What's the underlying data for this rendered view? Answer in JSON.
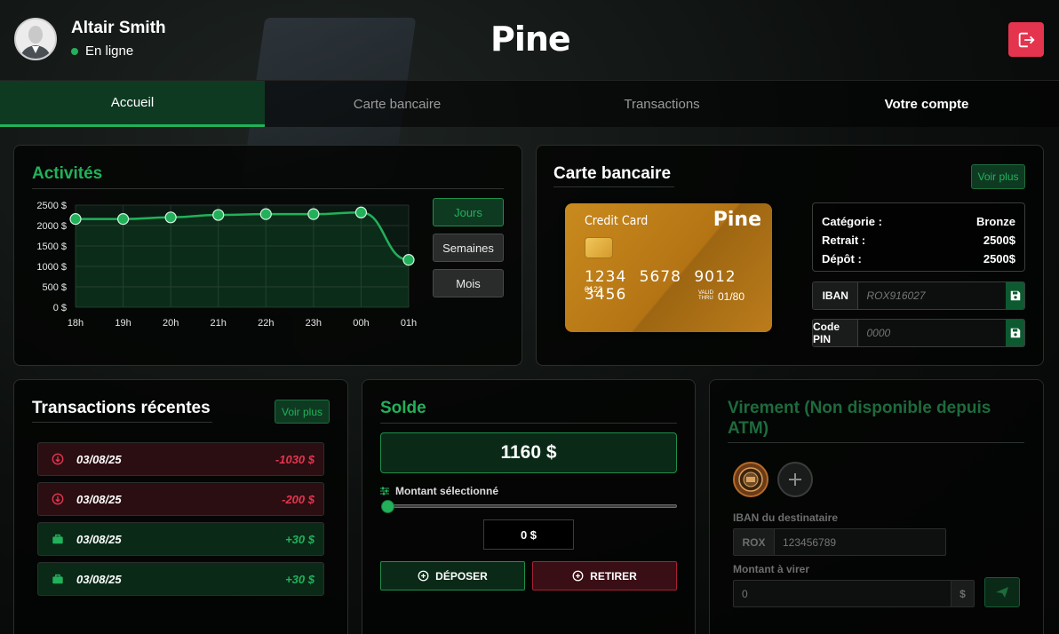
{
  "user": {
    "name": "Altair Smith",
    "status": "En ligne"
  },
  "logo": "Pine",
  "tabs": [
    {
      "label": "Accueil"
    },
    {
      "label": "Carte bancaire"
    },
    {
      "label": "Transactions"
    },
    {
      "label": "Votre compte"
    }
  ],
  "activity": {
    "title": "Activités",
    "buttons": [
      "Jours",
      "Semaines",
      "Mois"
    ]
  },
  "chart_data": {
    "type": "line",
    "title": "Activités",
    "x": [
      "18h",
      "19h",
      "20h",
      "21h",
      "22h",
      "23h",
      "00h",
      "01h"
    ],
    "y_ticks": [
      "2500 $",
      "2000 $",
      "1500 $",
      "1000 $",
      "500 $",
      "0 $"
    ],
    "series": [
      {
        "values": [
          2160,
          2160,
          2200,
          2260,
          2280,
          2280,
          2320,
          1160
        ]
      }
    ],
    "ylim": [
      0,
      2500
    ],
    "grid": true,
    "color": "#22b15a"
  },
  "card": {
    "title": "Carte bancaire",
    "voir_plus": "Voir plus",
    "card_label": "Credit Card",
    "card_logo": "Pine",
    "number": "1234 5678 9012 3456",
    "small_number": "0123",
    "valid_thru": "VALID THRU",
    "expiry": "01/80",
    "rows": [
      {
        "label": "Catégorie :",
        "value": "Bronze"
      },
      {
        "label": "Retrait :",
        "value": "2500$"
      },
      {
        "label": "Dépôt :",
        "value": "2500$"
      }
    ],
    "iban_label": "IBAN",
    "iban_value": "ROX916027",
    "pin_label": "Code PIN",
    "pin_value": "0000"
  },
  "transactions": {
    "title": "Transactions récentes",
    "voir_plus": "Voir plus",
    "items": [
      {
        "date": "03/08/25",
        "amount": "-1030 $",
        "kind": "neg"
      },
      {
        "date": "03/08/25",
        "amount": "-200 $",
        "kind": "neg"
      },
      {
        "date": "03/08/25",
        "amount": "+30 $",
        "kind": "pos"
      },
      {
        "date": "03/08/25",
        "amount": "+30 $",
        "kind": "pos"
      }
    ]
  },
  "solde": {
    "title": "Solde",
    "balance": "1160 $",
    "slider_label": "Montant sélectionné",
    "slider_value": 0,
    "amount": "0 $",
    "deposit": "DÉPOSER",
    "withdraw": "RETIRER"
  },
  "virement": {
    "title": "Virement (Non disponible depuis ATM)",
    "iban_label": "IBAN du destinataire",
    "iban_prefix": "ROX",
    "iban_placeholder": "123456789",
    "amount_label": "Montant à virer",
    "amount_placeholder": "0",
    "currency": "$"
  },
  "colors": {
    "accent": "#22b15a",
    "danger": "#e5344e",
    "dark_green": "#0e3a22"
  }
}
